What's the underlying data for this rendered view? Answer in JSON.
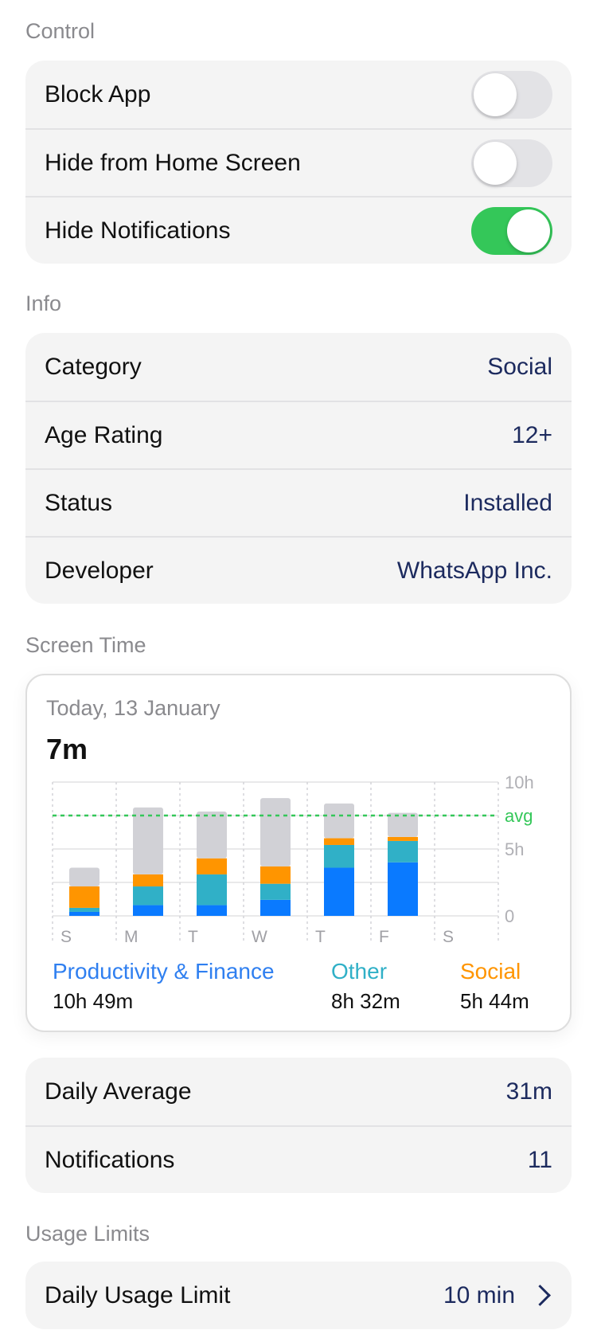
{
  "sections": {
    "control": "Control",
    "info": "Info",
    "screen_time": "Screen Time",
    "usage_limits": "Usage Limits"
  },
  "control": {
    "block_app": {
      "label": "Block App",
      "on": false
    },
    "hide_home": {
      "label": "Hide from Home Screen",
      "on": false
    },
    "hide_notifications": {
      "label": "Hide Notifications",
      "on": true
    }
  },
  "info": {
    "category": {
      "label": "Category",
      "value": "Social"
    },
    "age_rating": {
      "label": "Age Rating",
      "value": "12+"
    },
    "status": {
      "label": "Status",
      "value": "Installed"
    },
    "developer": {
      "label": "Developer",
      "value": "WhatsApp Inc."
    }
  },
  "screen_time": {
    "date": "Today, 13 January",
    "total": "7m",
    "legend": [
      {
        "name": "Productivity & Finance",
        "value": "10h 49m",
        "color": "#2f7ff0"
      },
      {
        "name": "Other",
        "value": "8h 32m",
        "color": "#30b0c7"
      },
      {
        "name": "Social",
        "value": "5h 44m",
        "color": "#ff9500"
      }
    ]
  },
  "chart_data": {
    "type": "bar",
    "stacked": true,
    "categories": [
      "S",
      "M",
      "T",
      "W",
      "T",
      "F",
      "S"
    ],
    "y_tick_labels": [
      "10h",
      "5h",
      "0"
    ],
    "avg_label": "avg",
    "avg_value": 7.5,
    "ylim": [
      0,
      10
    ],
    "series": [
      {
        "name": "Productivity & Finance",
        "color": "#0a7aff",
        "values": [
          0.3,
          0.8,
          0.8,
          1.2,
          3.6,
          4.0,
          0
        ]
      },
      {
        "name": "Other",
        "color": "#30b0c7",
        "values": [
          0.3,
          1.4,
          2.3,
          1.2,
          1.7,
          1.6,
          0
        ]
      },
      {
        "name": "Social",
        "color": "#ff9500",
        "values": [
          1.6,
          0.9,
          1.2,
          1.3,
          0.5,
          0.3,
          0
        ]
      },
      {
        "color": "#d1d1d6",
        "values": [
          1.4,
          5.0,
          3.5,
          5.1,
          2.6,
          1.8,
          0
        ]
      }
    ]
  },
  "stats": {
    "daily_average": {
      "label": "Daily Average",
      "value": "31m"
    },
    "notifications": {
      "label": "Notifications",
      "value": "11"
    }
  },
  "limits": {
    "daily_usage_limit": {
      "label": "Daily Usage Limit",
      "value": "10 min"
    }
  }
}
